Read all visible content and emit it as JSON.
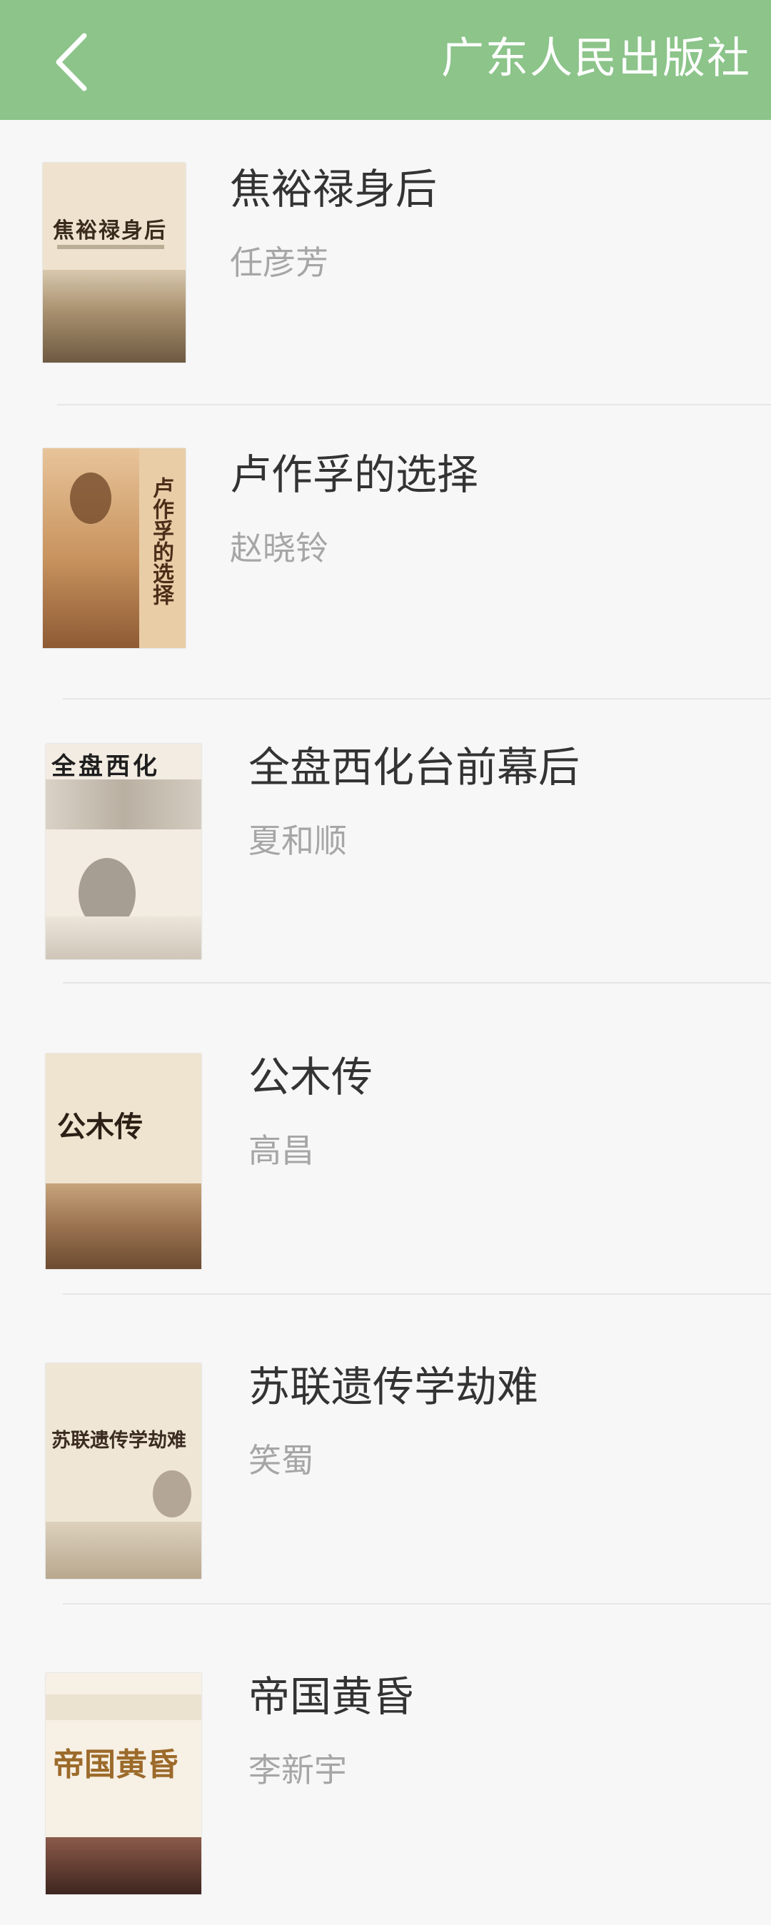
{
  "header": {
    "back_icon": "chevron-left-icon",
    "title": "广东人民出版社",
    "bar_color": "#8cc48a"
  },
  "books": [
    {
      "title": "焦裕禄身后",
      "author": "任彦芳",
      "cover_text": "焦裕禄身后"
    },
    {
      "title": "卢作孚的选择",
      "author": "赵晓铃",
      "cover_text": "卢作孚的选择"
    },
    {
      "title": "全盘西化台前幕后",
      "author": "夏和顺",
      "cover_text": "全盘西化"
    },
    {
      "title": "公木传",
      "author": "高昌",
      "cover_text": "公木传"
    },
    {
      "title": "苏联遗传学劫难",
      "author": "笑蜀",
      "cover_text": "苏联遗传学劫难"
    },
    {
      "title": "帝国黄昏",
      "author": "李新宇",
      "cover_text": "帝国黄昏"
    }
  ]
}
